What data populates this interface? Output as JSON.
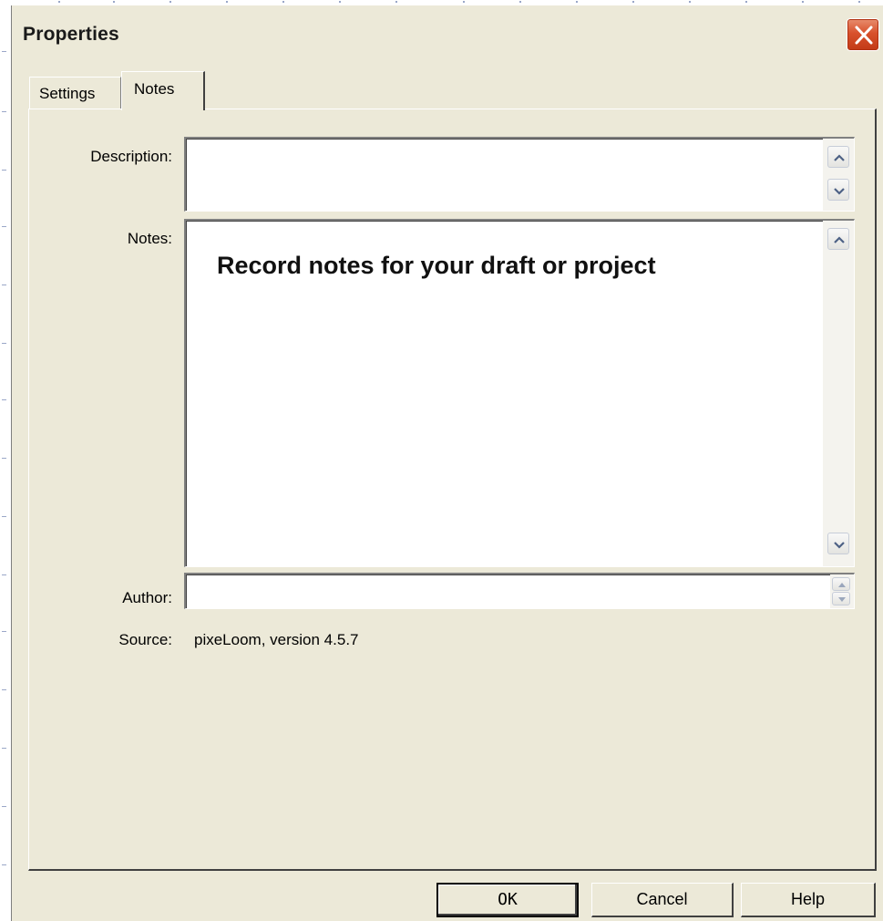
{
  "window": {
    "title": "Properties",
    "close_icon": "close-icon"
  },
  "tabs": [
    {
      "label": "Settings",
      "active": false
    },
    {
      "label": "Notes",
      "active": true
    }
  ],
  "form": {
    "description_label": "Description:",
    "description_value": "",
    "notes_label": "Notes:",
    "notes_value": "Record notes for your draft or project",
    "author_label": "Author:",
    "author_value": "",
    "source_label": "Source:",
    "source_value": "pixeLoom, version 4.5.7"
  },
  "buttons": {
    "ok": "OK",
    "cancel": "Cancel",
    "help": "Help"
  },
  "colors": {
    "dialog_bg": "#ece9d8",
    "close_button": "#d8512c"
  }
}
